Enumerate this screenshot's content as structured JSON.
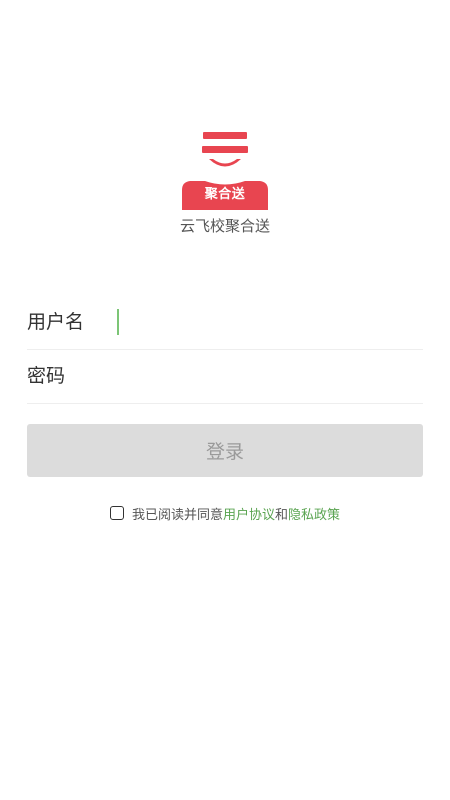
{
  "app": {
    "logo_text": "聚合送",
    "name": "云飞校聚合送"
  },
  "form": {
    "username_label": "用户名",
    "password_label": "密码",
    "username_value": "",
    "password_value": ""
  },
  "login_button": {
    "label": "登录"
  },
  "agreement": {
    "prefix": "我已阅读并同意",
    "user_agreement": "用户协议",
    "joiner": "和",
    "privacy_policy": "隐私政策",
    "checked": false
  },
  "colors": {
    "brand_red": "#e84550",
    "link_green": "#5aa451",
    "caret_green": "#7cc576",
    "button_disabled": "#dcdcdc"
  }
}
